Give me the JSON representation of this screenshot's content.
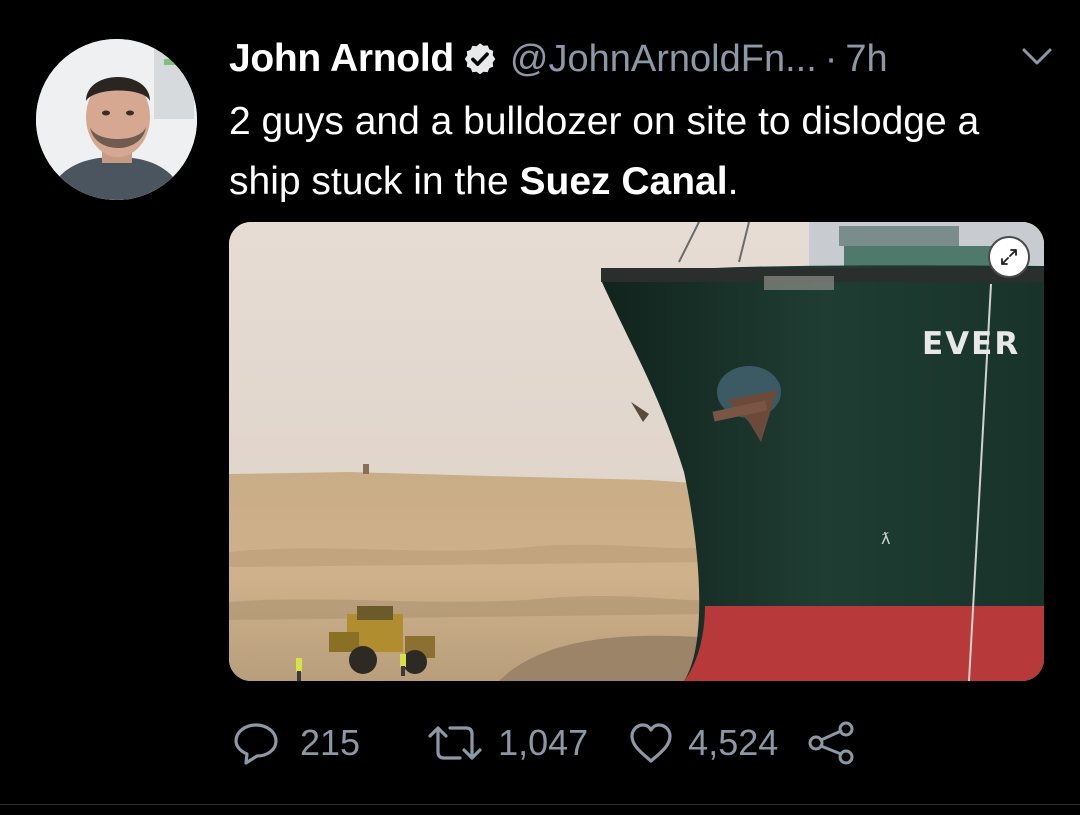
{
  "tweet": {
    "author_name": "John Arnold",
    "handle": "@JohnArnoldFn...",
    "separator": "·",
    "time": "7h",
    "text_before": "2 guys and a bulldozer on site to dislodge a ship stuck in the ",
    "text_bold": "Suez Canal",
    "text_after": "."
  },
  "media": {
    "ship_hull_text": "EVER"
  },
  "actions": {
    "replies": "215",
    "retweets": "1,047",
    "likes": "4,524"
  },
  "icons": {
    "verified": "verified-badge-icon",
    "more": "chevron-down-icon",
    "expand": "expand-icon",
    "reply": "reply-icon",
    "retweet": "retweet-icon",
    "like": "heart-icon",
    "share": "share-icon"
  },
  "colors": {
    "background": "#000000",
    "secondary_text": "#8b98a5",
    "divider": "#2f3336",
    "ship_hull": "#1d3a30",
    "ship_waterline": "#b8393a"
  }
}
